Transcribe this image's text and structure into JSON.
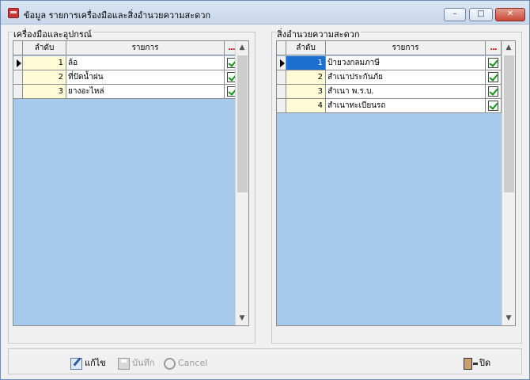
{
  "window": {
    "title": "ข้อมูล รายการเครื่องมือและสิ่งอำนวยความสะดวก",
    "controls": {
      "minimize": "–",
      "maximize": "□",
      "close": "✕"
    }
  },
  "left_panel": {
    "group_label": "เครื่องมือและอุปกรณ์",
    "columns": {
      "order": "ลำดับ",
      "item": "รายการ",
      "more": "..."
    },
    "rows": [
      {
        "order": "1",
        "item": "ล้อ",
        "checked": true
      },
      {
        "order": "2",
        "item": "ที่ปัดน้ำฝน",
        "checked": true
      },
      {
        "order": "3",
        "item": "ยางอะไหล่",
        "checked": true
      }
    ]
  },
  "right_panel": {
    "group_label": "สิ่งอำนวยความสะดวก",
    "columns": {
      "order": "ลำดับ",
      "item": "รายการ",
      "more": "..."
    },
    "rows": [
      {
        "order": "1",
        "item": "ป้ายวงกลมภาษี",
        "checked": true
      },
      {
        "order": "2",
        "item": "สำเนาประกันภัย",
        "checked": true
      },
      {
        "order": "3",
        "item": "สำเนา พ.ร.บ.",
        "checked": true
      },
      {
        "order": "4",
        "item": "สำเนาทะเบียนรถ",
        "checked": true
      }
    ]
  },
  "toolbar": {
    "edit_label": "แก้ไข",
    "save_label": "บันทึก",
    "cancel_label": "Cancel",
    "close_label": "ปิด"
  }
}
